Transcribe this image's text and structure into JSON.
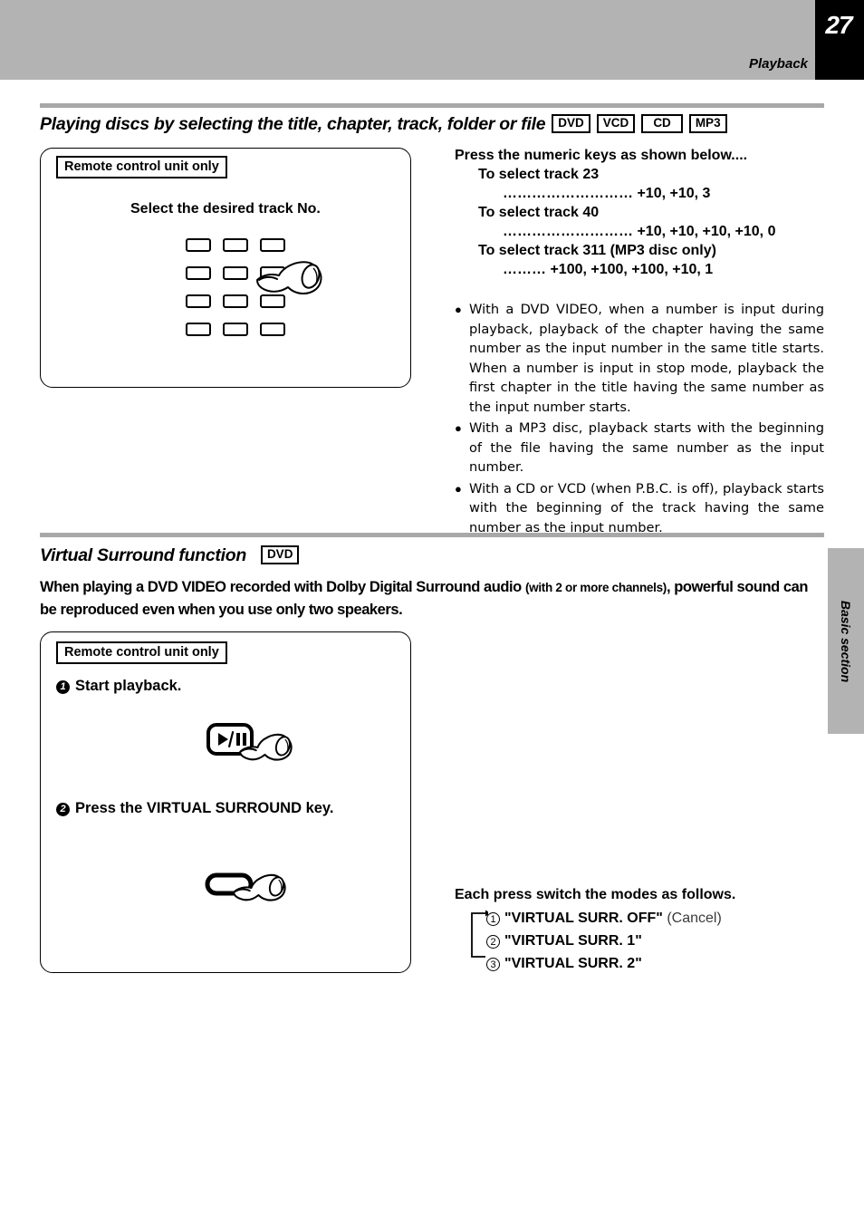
{
  "header": {
    "page_number": "27",
    "section_label": "Playback"
  },
  "side_tab": {
    "label": "Basic section"
  },
  "section1": {
    "title": "Playing discs by selecting the title, chapter, track, folder or file",
    "badges": [
      "DVD",
      "VCD",
      "CD",
      "MP3"
    ],
    "illustration": {
      "remote_only_label": "Remote control unit only",
      "caption": "Select the desired track No.",
      "icon": "hand-pointing-icon",
      "keypad_rows": 4,
      "keypad_cols": 3
    },
    "instructions": {
      "heading": "Press the numeric keys as shown below....",
      "items": [
        {
          "label": "To select track 23",
          "keys": "………………………  +10, +10, 3"
        },
        {
          "label": "To select track 40",
          "keys": "………………………  +10, +10, +10, +10, 0"
        },
        {
          "label": "To select track 311 (MP3 disc only)",
          "keys": "………  +100, +100, +100, +10, 1"
        }
      ]
    },
    "notes": [
      "With a DVD VIDEO, when a number is input during playback, playback of the chapter having the same number as the input number in the same title starts. When a number is input in stop mode, playback the first chapter in the title having the same number as the input number starts.",
      "With a MP3 disc, playback starts with the beginning of the file having the same number as the input number.",
      "With a CD or VCD (when P.B.C. is off), playback starts with the beginning of the track having the same number as the input number."
    ]
  },
  "section2": {
    "title": "Virtual Surround function",
    "badges": [
      "DVD"
    ],
    "intro_part1": "When playing a DVD VIDEO recorded with Dolby Digital Surround audio ",
    "intro_small": "(with 2 or more channels)",
    "intro_part2": ", powerful sound can be reproduced even when you use only two speakers.",
    "illustration": {
      "remote_only_label": "Remote control unit only",
      "step1": "Start playback.",
      "step1_num": "1",
      "step1_key_icon": "play-pause-key-icon",
      "step2": "Press the VIRTUAL SURROUND key.",
      "step2_num": "2",
      "step2_key_icon": "virtual-surround-key-icon",
      "hand_icon": "hand-pointing-icon"
    },
    "modes": {
      "heading": "Each press switch the modes as follows.",
      "items": [
        {
          "num": "1",
          "label": "\"VIRTUAL SURR. OFF\"",
          "note": " (Cancel)"
        },
        {
          "num": "2",
          "label": "\"VIRTUAL SURR. 1\"",
          "note": ""
        },
        {
          "num": "3",
          "label": "\"VIRTUAL SURR. 2\"",
          "note": ""
        }
      ]
    }
  },
  "colors": {
    "header_gray": "#b3b3b3",
    "rule_gray": "#a8a8a8",
    "black": "#000000"
  }
}
